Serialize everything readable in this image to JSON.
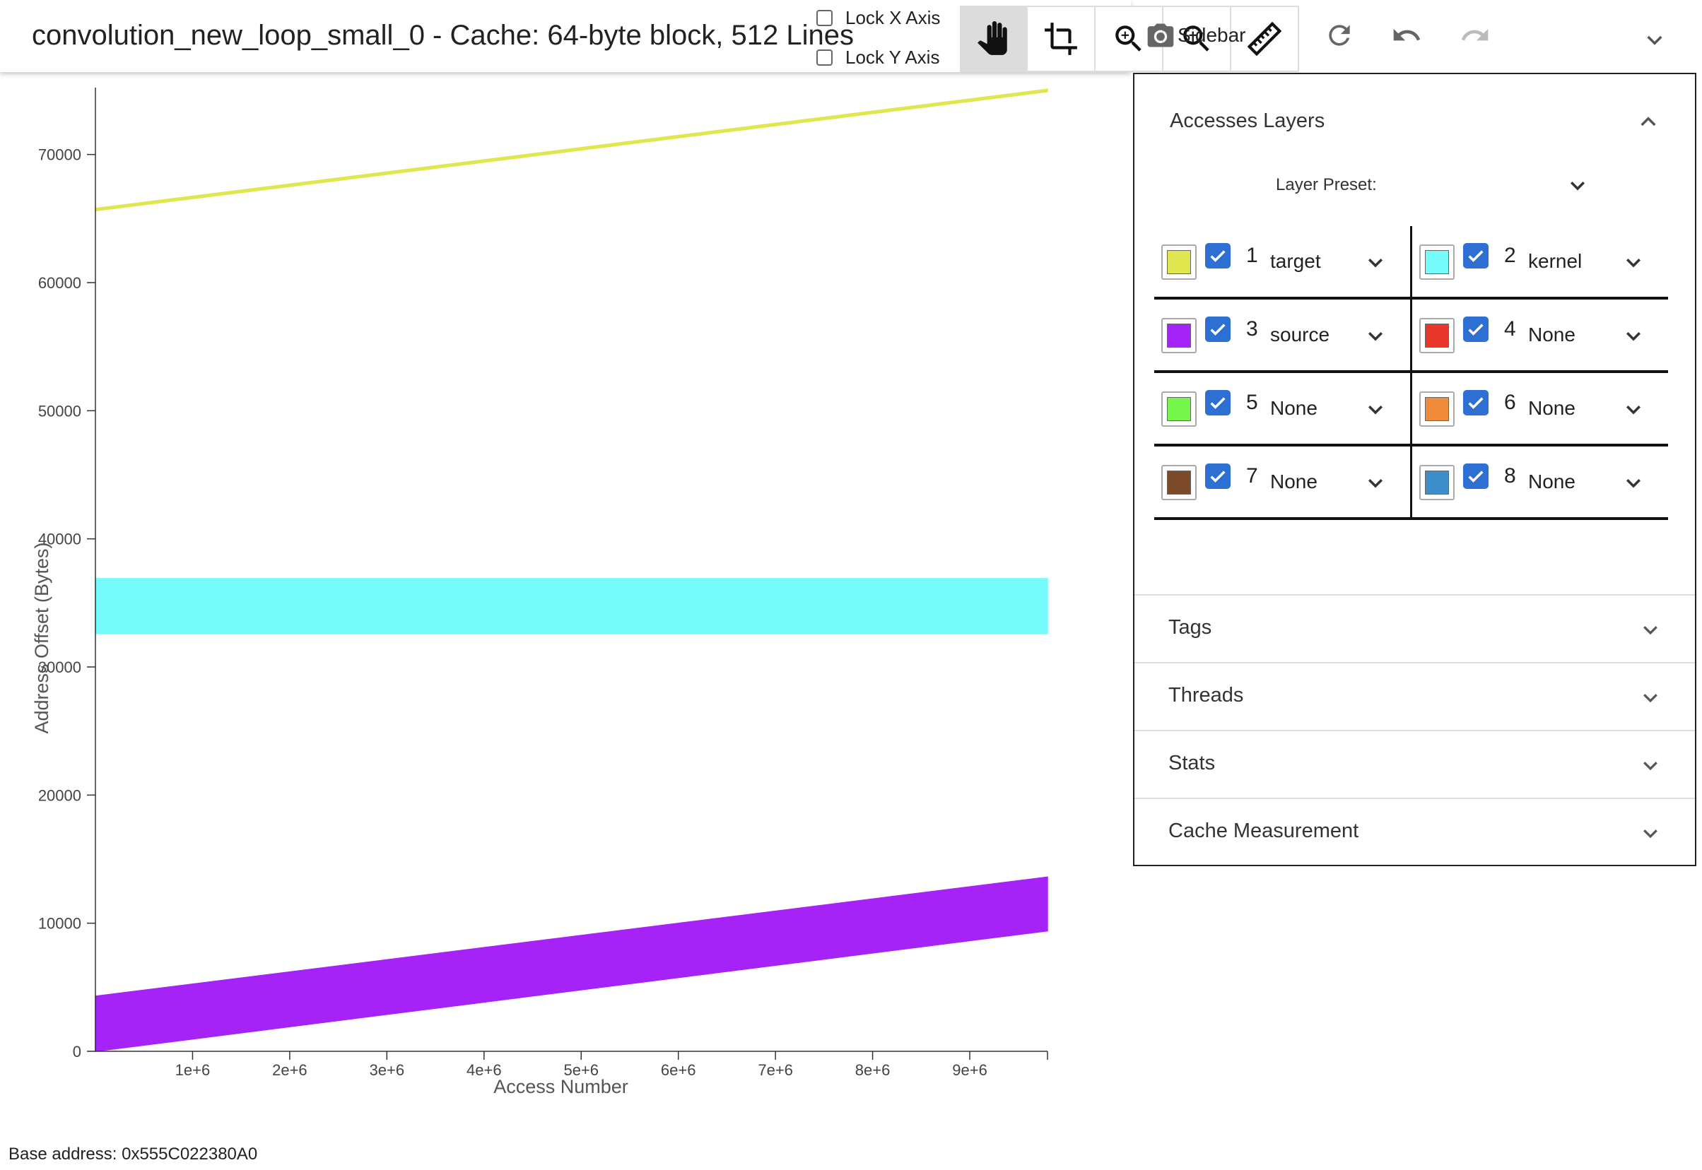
{
  "header": {
    "title": "convolution_new_loop_small_0 - Cache: 64-byte block, 512 Lines",
    "lock_x_label": "Lock X Axis",
    "lock_y_label": "Lock Y Axis",
    "sidebar_label": "Sidebar",
    "tools": [
      "hand-icon",
      "crop-icon",
      "zoom-in-icon",
      "zoom-out-icon",
      "ruler-icon"
    ],
    "actions": [
      "refresh-icon",
      "undo-icon",
      "redo-icon",
      "camera-icon",
      "chevron-down-icon"
    ]
  },
  "chart_data": {
    "type": "area",
    "xlabel": "Access Number",
    "ylabel": "Address Offset (Bytes)",
    "xlim": [
      0,
      9800000
    ],
    "ylim": [
      0,
      75000
    ],
    "x_ticks": [
      "1e+6",
      "2e+6",
      "3e+6",
      "4e+6",
      "5e+6",
      "6e+6",
      "7e+6",
      "8e+6",
      "9e+6"
    ],
    "y_ticks": [
      "0",
      "10000",
      "20000",
      "30000",
      "40000",
      "50000",
      "60000",
      "70000"
    ],
    "series": [
      {
        "name": "target",
        "color": "#e0e64e",
        "x": [
          0,
          9800000
        ],
        "y_low": [
          65600,
          74900
        ],
        "y_high": [
          65800,
          75100
        ]
      },
      {
        "name": "kernel",
        "color": "#76fbfb",
        "x": [
          0,
          9800000
        ],
        "y_low": [
          32600,
          32600
        ],
        "y_high": [
          36900,
          36900
        ]
      },
      {
        "name": "source",
        "color": "#a623f8",
        "x": [
          0,
          9800000
        ],
        "y_low": [
          0,
          9400
        ],
        "y_high": [
          4300,
          13600
        ]
      }
    ]
  },
  "footer": {
    "base_address": "Base address: 0x555C022380A0"
  },
  "panel": {
    "title": "Accesses Layers",
    "preset_label": "Layer Preset:",
    "layers": [
      {
        "num": "1",
        "name": "target",
        "color": "#e0e64e"
      },
      {
        "num": "2",
        "name": "kernel",
        "color": "#76fbfb"
      },
      {
        "num": "3",
        "name": "source",
        "color": "#a623f8"
      },
      {
        "num": "4",
        "name": "None",
        "color": "#e8362a"
      },
      {
        "num": "5",
        "name": "None",
        "color": "#76f54a"
      },
      {
        "num": "6",
        "name": "None",
        "color": "#ef8b3a"
      },
      {
        "num": "7",
        "name": "None",
        "color": "#7a4a2a"
      },
      {
        "num": "8",
        "name": "None",
        "color": "#3d8ecb"
      }
    ],
    "sections": [
      "Tags",
      "Threads",
      "Stats",
      "Cache Measurement"
    ]
  }
}
